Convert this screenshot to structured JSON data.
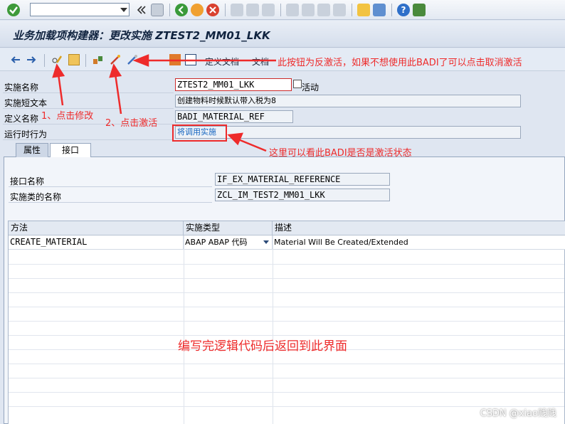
{
  "window": {
    "title": "业务加载项构建器：更改实施 ZTEST2_MM01_LKK"
  },
  "system_toolbar": {
    "command_value": "",
    "icons": [
      "enter-icon",
      "back-double-arrow-icon",
      "save-icon",
      "back-icon",
      "exit-icon",
      "cancel-icon",
      "print-icon",
      "find-icon",
      "find-next-icon",
      "first-page-icon",
      "prev-page-icon",
      "next-page-icon",
      "last-page-icon",
      "new-session-icon",
      "shortcut-icon",
      "help-icon",
      "customize-icon"
    ]
  },
  "app_toolbar": {
    "icons": [
      "arrow-left-icon",
      "arrow-right-icon",
      "display-change-icon",
      "object-list-icon",
      "activate-icon",
      "deactivate-icon",
      "where-used-icon",
      "hierarchy-icon",
      "info-icon"
    ],
    "text_buttons": [
      "定义文档",
      "文档"
    ]
  },
  "header": {
    "impl_name_label": "实施名称",
    "impl_name_value": "ZTEST2_MM01_LKK",
    "active_suffix": "活动",
    "short_text_label": "实施短文本",
    "short_text_value": "创建物料时候默认带入税为8",
    "definition_label": "定义名称",
    "definition_value": "BADI_MATERIAL_REF",
    "runtime_label": "运行时行为",
    "runtime_value": "将调用实施"
  },
  "tabs": [
    "属性",
    "接口"
  ],
  "interface": {
    "iface_name_label": "接口名称",
    "iface_name_value": "IF_EX_MATERIAL_REFERENCE",
    "class_label": "实施类的名称",
    "class_value": "ZCL_IM_TEST2_MM01_LKK"
  },
  "table": {
    "headers": [
      "方法",
      "实施类型",
      "描述"
    ],
    "rows": [
      {
        "method": "CREATE_MATERIAL",
        "type": "ABAP ABAP 代码",
        "desc": "Material Will Be Created/Extended"
      }
    ]
  },
  "annotations": {
    "deactivate_note": "此按钮为反激活，如果不想使用此BADI了可以点击取消激活",
    "step1": "1、点击修改",
    "step2": "2、点击激活",
    "status_note": "这里可以看此BADI是否是激活状态",
    "center_note": "编写完逻辑代码后返回到此界面"
  },
  "watermark": "CSDN @xiao贱贱",
  "colors": {
    "annotation": "#ee2b2b",
    "toolbar_bg": "#e4ebf5",
    "title_text": "#10233f",
    "runtime_text": "#1565c0"
  }
}
